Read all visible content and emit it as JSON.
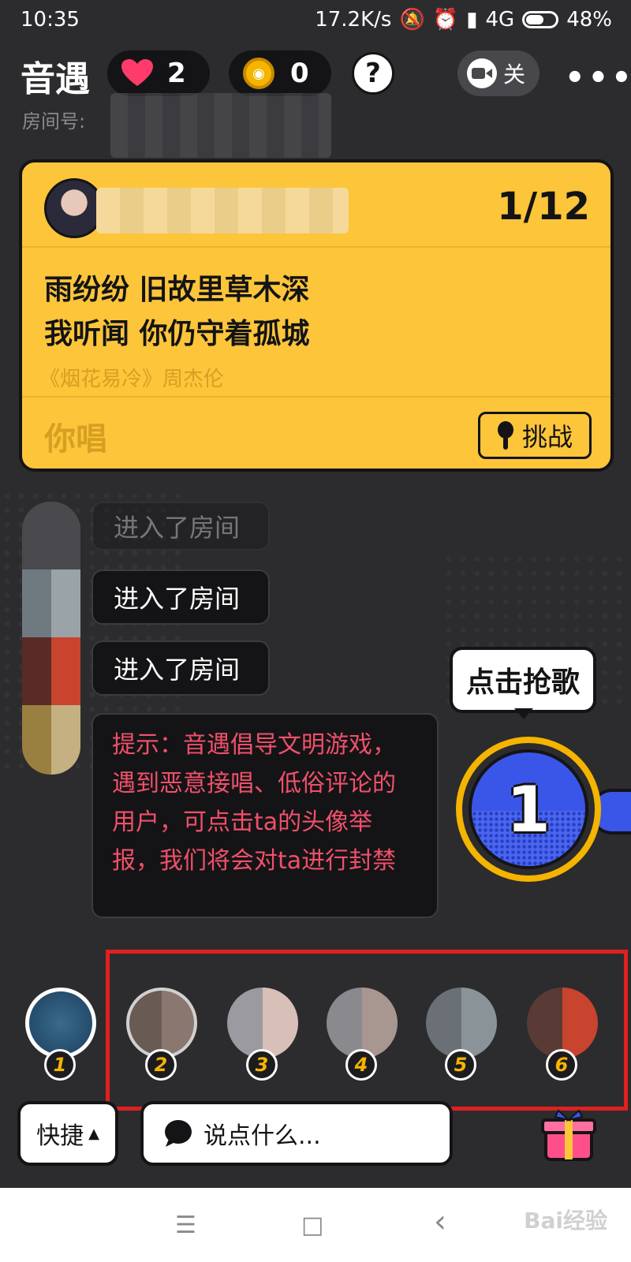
{
  "status_bar": {
    "time": "10:35",
    "net_speed": "17.2K/s",
    "network": "4G",
    "battery": "48%"
  },
  "header": {
    "app_name": "音遇",
    "hearts": "2",
    "coins": "0",
    "help": "?",
    "camera_label": "关",
    "more": "•••",
    "room_label": "房间号:"
  },
  "song_card": {
    "counter": "1/12",
    "lyric_line1": "雨纷纷 旧故里草木深",
    "lyric_line2": "我听闻 你仍守着孤城",
    "song_info": "《烟花易冷》周杰伦",
    "you_sing": "你唱",
    "challenge_label": "挑战"
  },
  "chat": {
    "messages": [
      "进入了房间",
      "进入了房间",
      "进入了房间"
    ],
    "tip": "提示：音遇倡导文明游戏，遇到恶意接唱、低俗评论的用户，可点击ta的头像举报，我们将会对ta进行封禁"
  },
  "grab": {
    "bubble": "点击抢歌",
    "number": "1"
  },
  "seats": [
    "1",
    "2",
    "3",
    "4",
    "5",
    "6"
  ],
  "bottom_bar": {
    "quick_label": "快捷",
    "say_placeholder": "说点什么..."
  },
  "nav": {
    "menu": "☰",
    "home": "□",
    "back": "‹"
  },
  "watermark": "Bai经验",
  "colors": {
    "card_yellow": "#fcc53a",
    "tip_red": "#f0506a",
    "grab_blue": "#3a56e8",
    "highlight_red": "#e02020"
  }
}
